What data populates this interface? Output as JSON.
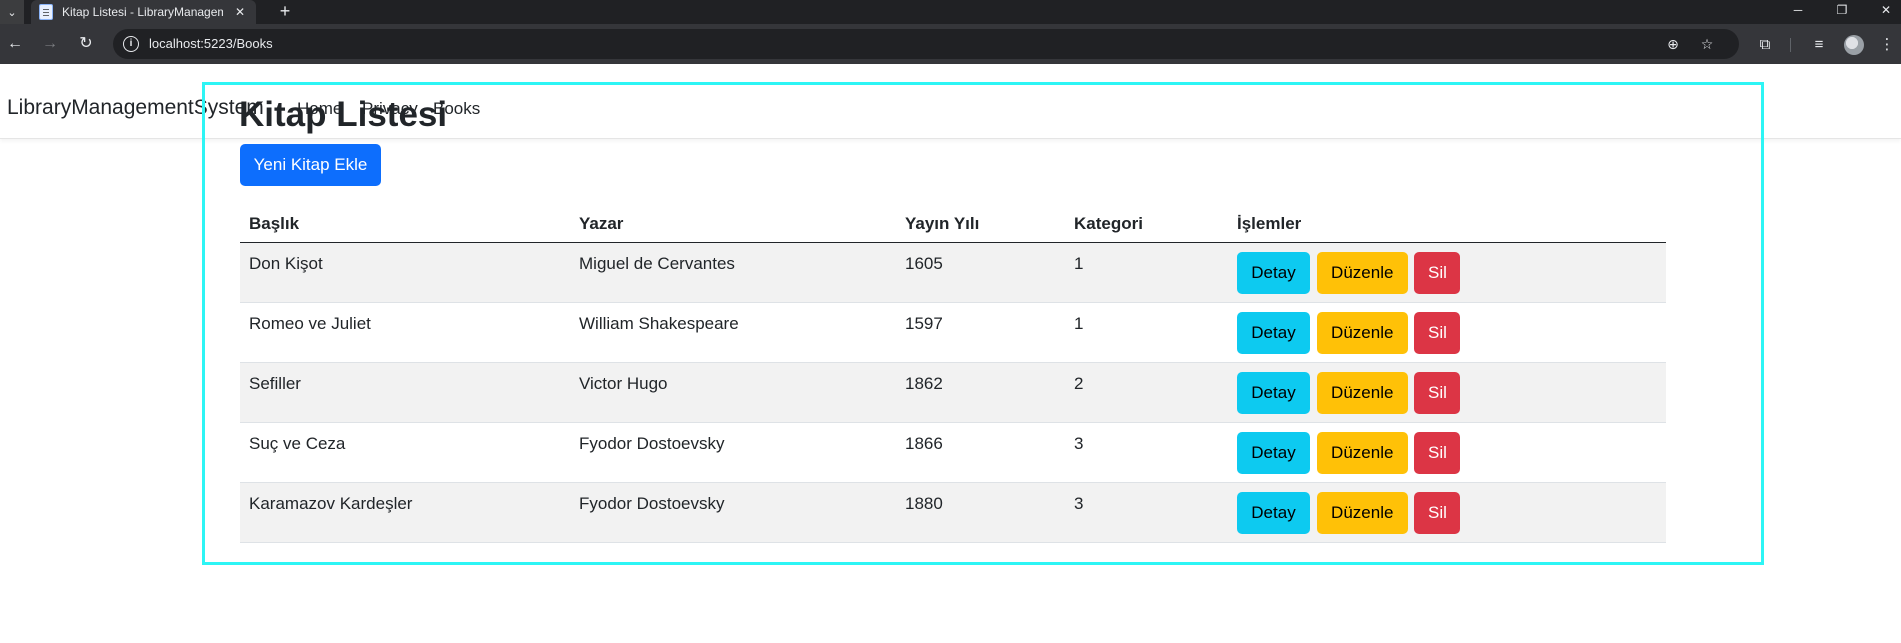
{
  "browser": {
    "tab_title": "Kitap Listesi - LibraryManageme",
    "url": "localhost:5223/Books"
  },
  "navbar": {
    "brand": "LibraryManagementSystem",
    "links": [
      "Home",
      "Privacy",
      "Books"
    ]
  },
  "main": {
    "title": "Kitap Listesi",
    "add_button": "Yeni Kitap Ekle"
  },
  "table": {
    "headers": [
      "Başlık",
      "Yazar",
      "Yayın Yılı",
      "Kategori",
      "İşlemler"
    ],
    "rows": [
      {
        "title": "Don Kişot",
        "author": "Miguel de Cervantes",
        "year": "1605",
        "category": "1"
      },
      {
        "title": "Romeo ve Juliet",
        "author": "William Shakespeare",
        "year": "1597",
        "category": "1"
      },
      {
        "title": "Sefiller",
        "author": "Victor Hugo",
        "year": "1862",
        "category": "2"
      },
      {
        "title": "Suç ve Ceza",
        "author": "Fyodor Dostoevsky",
        "year": "1866",
        "category": "3"
      },
      {
        "title": "Karamazov Kardeşler",
        "author": "Fyodor Dostoevsky",
        "year": "1880",
        "category": "3"
      }
    ],
    "actions": {
      "detail": "Detay",
      "edit": "Düzenle",
      "delete": "Sil"
    }
  },
  "colors": {
    "primary": "#0d6efd",
    "info": "#0dcaf0",
    "warning": "#ffc107",
    "danger": "#dc3545",
    "highlight_frame": "#2df5f5"
  }
}
